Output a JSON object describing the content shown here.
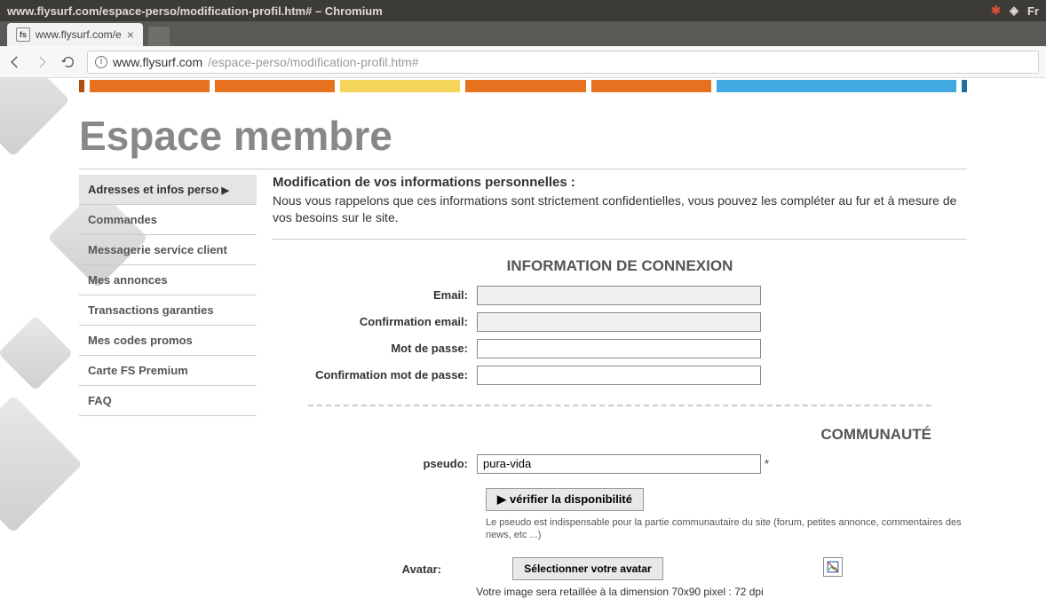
{
  "os": {
    "title": "www.flysurf.com/espace-perso/modification-profil.htm# – Chromium",
    "lang": "Fr"
  },
  "browser": {
    "tab_title": "www.flysurf.com/e",
    "url_host": "www.flysurf.com",
    "url_path": "/espace-perso/modification-profil.htm#"
  },
  "page": {
    "title": "Espace membre"
  },
  "sidebar": {
    "items": [
      {
        "label": "Adresses et infos perso",
        "active": true
      },
      {
        "label": "Commandes"
      },
      {
        "label": "Messagerie service client"
      },
      {
        "label": "Mes annonces"
      },
      {
        "label": "Transactions garanties"
      },
      {
        "label": "Mes codes promos"
      },
      {
        "label": "Carte FS Premium"
      },
      {
        "label": "FAQ"
      }
    ]
  },
  "intro": {
    "title": "Modification de vos informations personnelles :",
    "text": "Nous vous rappelons que ces informations sont strictement confidentielles, vous pouvez les compléter au fur et à mesure de vos besoins sur le site."
  },
  "sections": {
    "connexion": {
      "title": "INFORMATION DE CONNEXION",
      "email_label": "Email:",
      "email_value": "",
      "confirm_email_label": "Confirmation email:",
      "confirm_email_value": "",
      "password_label": "Mot de passe:",
      "password_value": "",
      "confirm_password_label": "Confirmation mot de passe:",
      "confirm_password_value": ""
    },
    "communaute": {
      "title": "COMMUNAUTÉ",
      "pseudo_label": "pseudo:",
      "pseudo_value": "pura-vida",
      "check_button": "vérifier la disponibilité",
      "pseudo_note": "Le pseudo est indispensable pour la partie communautaire du site (forum, petites annonce, commentaires des news, etc ...)",
      "avatar_label": "Avatar:",
      "avatar_button": "Sélectionner votre avatar",
      "avatar_note": "Votre image sera retaillée à la dimension 70x90 pixel : 72 dpi"
    }
  }
}
